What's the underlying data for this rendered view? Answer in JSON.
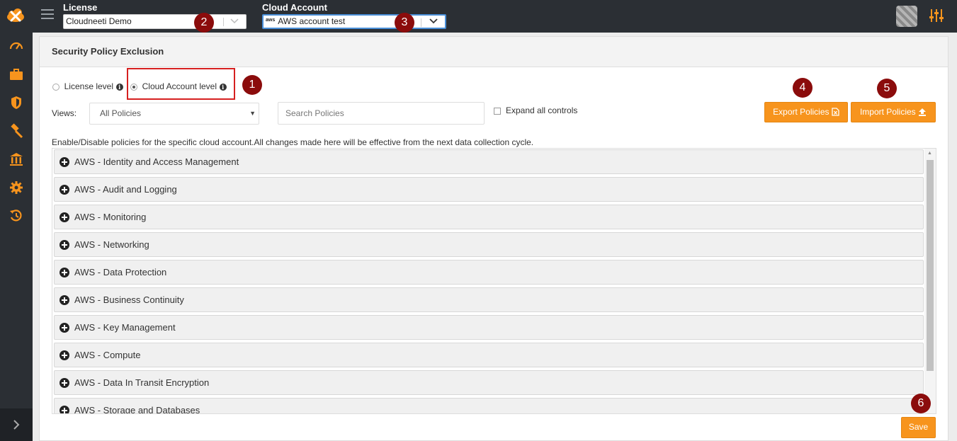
{
  "topbar": {
    "license_label": "License",
    "license_value": "Cloudneeti Demo",
    "cloud_account_label": "Cloud Account",
    "cloud_account_value": "AWS account test",
    "cloud_account_badge": "aws"
  },
  "markers": [
    "1",
    "2",
    "3",
    "4",
    "5",
    "6"
  ],
  "panel": {
    "title": "Security Policy Exclusion",
    "radio_license": "License level",
    "radio_cloud": "Cloud Account level",
    "selected_level": "Cloud Account level",
    "views_label": "Views:",
    "views_value": "All Policies",
    "search_placeholder": "Search Policies",
    "expand_label": "Expand all controls",
    "export_label": "Export Policies",
    "import_label": "Import Policies",
    "description": "Enable/Disable policies for the specific cloud account.All changes made here will be effective from the next data collection cycle.",
    "save_label": "Save"
  },
  "policy_groups": [
    "AWS - Identity and Access Management",
    "AWS - Audit and Logging",
    "AWS - Monitoring",
    "AWS - Networking",
    "AWS - Data Protection",
    "AWS - Business Continuity",
    "AWS - Key Management",
    "AWS - Compute",
    "AWS - Data In Transit Encryption",
    "AWS - Storage and Databases"
  ],
  "sidebar": {
    "icons": [
      "dashboard-icon",
      "briefcase-icon",
      "shield-icon",
      "hammer-icon",
      "bank-icon",
      "gear-icon",
      "history-icon"
    ]
  },
  "colors": {
    "accent": "#f7941d",
    "marker": "#8b0c0c",
    "topbar": "#2b2f34",
    "highlight": "#d62020"
  }
}
